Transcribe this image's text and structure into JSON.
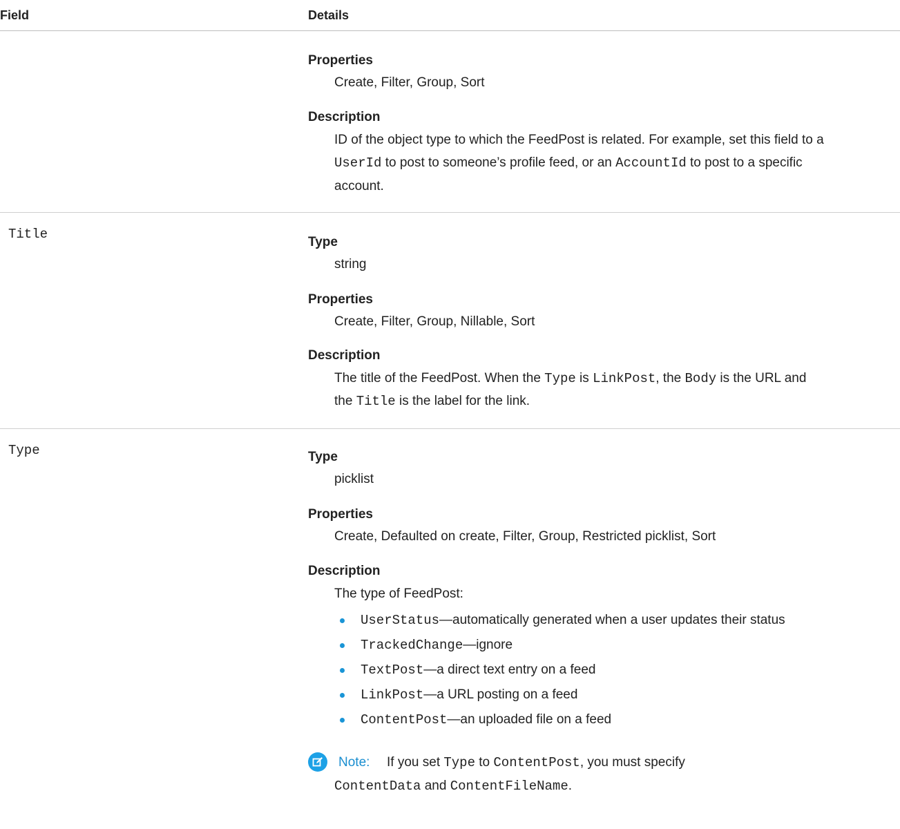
{
  "header": {
    "field": "Field",
    "details": "Details"
  },
  "row0": {
    "properties_label": "Properties",
    "properties": "Create, Filter, Group, Sort",
    "description_label": "Description",
    "desc_line1": "ID of the object type to which the FeedPost is related. For example, set this field to a",
    "desc_line2_code1": "UserId",
    "desc_line2_text1": " to post to someone’s profile feed, or an ",
    "desc_line2_code2": "AccountId",
    "desc_line2_text2": " to post to a specific",
    "desc_line3": "account."
  },
  "row_title": {
    "field": "Title",
    "type_label": "Type",
    "type": "string",
    "properties_label": "Properties",
    "properties": "Create, Filter, Group, Nillable, Sort",
    "description_label": "Description",
    "d1_text1": "The title of the FeedPost. When the ",
    "d1_code1": "Type",
    "d1_text2": " is ",
    "d1_code2": "LinkPost",
    "d1_text3": ", the ",
    "d1_code3": "Body",
    "d1_text4": " is the URL and",
    "d2_text1": "the ",
    "d2_code1": "Title",
    "d2_text2": " is the label for the link."
  },
  "row_type": {
    "field": "Type",
    "type_label": "Type",
    "type": "picklist",
    "properties_label": "Properties",
    "properties": "Create, Defaulted on create, Filter, Group, Restricted picklist, Sort",
    "description_label": "Description",
    "desc_intro": "The type of FeedPost:",
    "bullets": [
      {
        "code": "UserStatus",
        "text": "—automatically generated when a user updates their status"
      },
      {
        "code": "TrackedChange",
        "text": "—ignore"
      },
      {
        "code": "TextPost",
        "text": "—a direct text entry on a feed"
      },
      {
        "code": "LinkPost",
        "text": "—a URL posting on a feed"
      },
      {
        "code": "ContentPost",
        "text": "—an uploaded file on a feed"
      }
    ],
    "note": {
      "icon": "edit-note-icon",
      "label": "Note:",
      "t1": " If you set ",
      "c1": "Type",
      "t2": " to ",
      "c2": "ContentPost",
      "t3": ", you must specify",
      "c3": "ContentData",
      "t4": " and ",
      "c4": "ContentFileName",
      "t5": "."
    }
  }
}
